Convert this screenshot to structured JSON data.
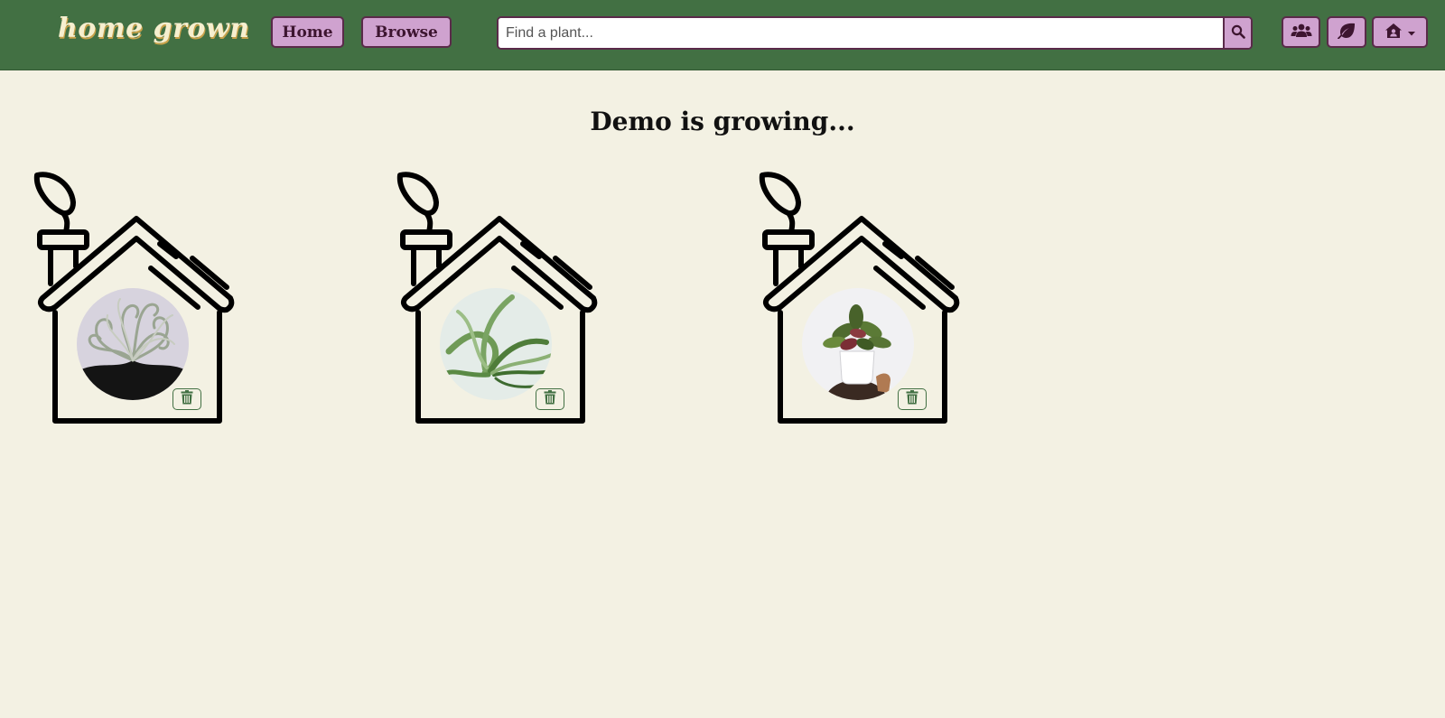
{
  "app": {
    "logo_text": "home grown"
  },
  "nav": {
    "home_label": "Home",
    "browse_label": "Browse"
  },
  "search": {
    "placeholder": "Find a plant...",
    "value": "",
    "icon": "search-icon"
  },
  "toolbar": {
    "friends_icon": "users-icon",
    "plants_icon": "leaf-icon",
    "account_icon": "house-user-dropdown-icon"
  },
  "page": {
    "title": "Demo is growing..."
  },
  "plants": [
    {
      "photo": "air plant with curly silver leaves",
      "delete_icon": "trash-icon"
    },
    {
      "photo": "air plant with green curving leaves",
      "delete_icon": "trash-icon"
    },
    {
      "photo": "potted calathea held in hand",
      "delete_icon": "trash-icon"
    }
  ],
  "colors": {
    "navbar": "#427043",
    "page_background": "#f3f1e3",
    "button": "#cfa2cf",
    "button_border": "#5a2a4a",
    "logo": "#f6efcf",
    "delete_accent": "#427043"
  }
}
